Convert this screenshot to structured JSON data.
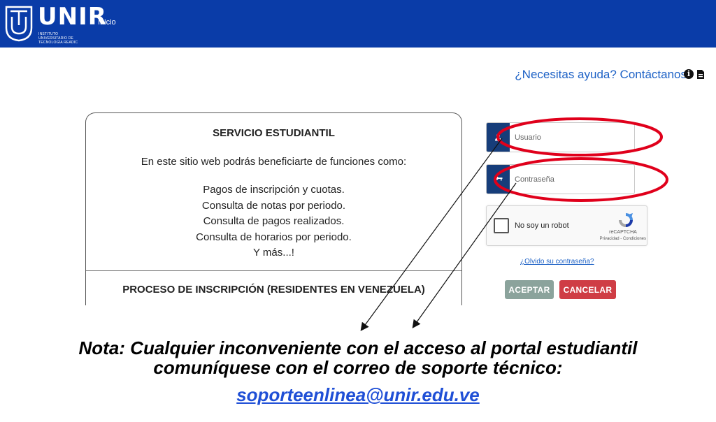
{
  "header": {
    "logo_text": "UNIR",
    "logo_subtitle": "Instituto Universitario de Tecnología Readic",
    "nav_inicio": "Inicio",
    "bg_color": "#0a3ca8"
  },
  "help": {
    "link_text": "¿Necesitas ayuda? Contáctanos",
    "icons": [
      "info-icon",
      "document-icon"
    ]
  },
  "card": {
    "title": "SERVICIO ESTUDIANTIL",
    "intro": "En este sitio web podrás beneficiarte de funciones como:",
    "items": [
      "Pagos de inscripción y cuotas.",
      "Consulta de notas por periodo.",
      "Consulta de pagos realizados.",
      "Consulta de horarios por periodo.",
      "Y más...!"
    ],
    "section2_title": "PROCESO DE INSCRIPCIÓN (RESIDENTES EN VENEZUELA)"
  },
  "login": {
    "user_placeholder": "Usuario",
    "password_placeholder": "Contraseña",
    "user_icon": "user-icon",
    "password_icon": "key-icon",
    "recaptcha_label": "No soy un robot",
    "recaptcha_brand": "reCAPTCHA",
    "recaptcha_terms": "Privacidad - Condiciones",
    "forgot_link": "¿Olvido su contraseña?",
    "accept_button": "ACEPTAR",
    "cancel_button": "CANCELAR",
    "accept_color": "#8ba39c",
    "cancel_color": "#cf3d45",
    "icon_bg_color": "#163d7a"
  },
  "annotation": {
    "highlight_color": "#e0001b",
    "note_line1": "Nota: Cualquier inconveniente con el acceso al portal estudiantil",
    "note_line2": "comuníquese con el correo de soporte técnico:",
    "email": "soporteenlinea@unir.edu.ve"
  }
}
